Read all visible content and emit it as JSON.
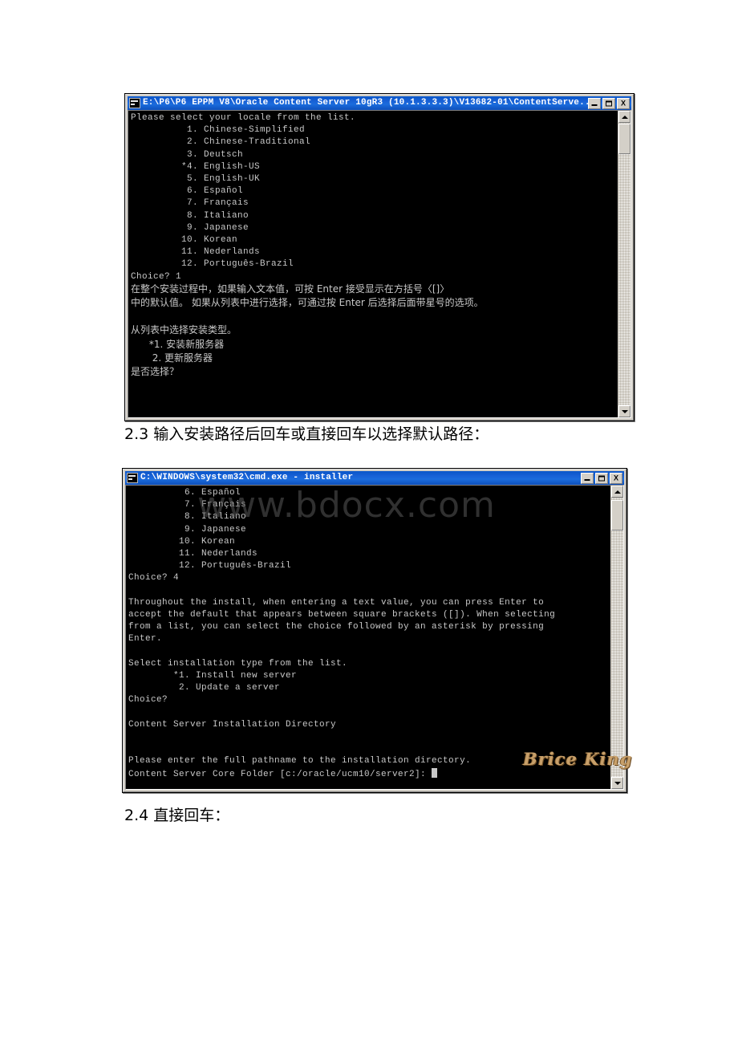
{
  "document": {
    "section_2_3": "2.3 输入安装路径后回车或直接回车以选择默认路径：",
    "section_2_4": "2.4 直接回车："
  },
  "watermarks": {
    "site": "www.bdocx.com",
    "author": "Brice King"
  },
  "window_locale": {
    "title": "E:\\P6\\P6 EPPM V8\\Oracle Content Server 10gR3  (10.1.3.3.3)\\V13682-01\\ContentServe...",
    "icon": "console-icon",
    "buttons": {
      "minimize": "minimize-button",
      "maximize": "maximize-button",
      "close_label": "X"
    },
    "console": "Please select your locale from the list.\n          1. Chinese-Simplified\n          2. Chinese-Traditional\n          3. Deutsch\n         *4. English-US\n          5. English-UK\n          6. Español\n          7. Français\n          8. Italiano\n          9. Japanese\n         10. Korean\n         11. Nederlands\n         12. Português-Brazil\nChoice? 1\n",
    "console_cn": "在整个安装过程中，如果输入文本值，可按 Enter 接受显示在方括号〈[]〉\n中的默认值。 如果从列表中进行选择，可通过按 Enter 后选择后面带星号的选项。\n\n从列表中选择安装类型。\n      *1. 安装新服务器\n       2. 更新服务器\n是否选择？",
    "scrollbar": {
      "up_arrow": "scroll-up-arrow",
      "down_arrow": "scroll-down-arrow",
      "thumb": "scroll-thumb"
    }
  },
  "window_installer": {
    "title": "C:\\WINDOWS\\system32\\cmd.exe - installer",
    "icon": "console-icon",
    "buttons": {
      "minimize": "minimize-button",
      "maximize": "maximize-button",
      "close_label": "X"
    },
    "console": "          6. Español\n          7. Français\n          8. Italiano\n          9. Japanese\n         10. Korean\n         11. Nederlands\n         12. Português-Brazil\nChoice? 4\n\nThroughout the install, when entering a text value, you can press Enter to\naccept the default that appears between square brackets ([]). When selecting\nfrom a list, you can select the choice followed by an asterisk by pressing\nEnter.\n\nSelect installation type from the list.\n        *1. Install new server\n         2. Update a server\nChoice?\n\nContent Server Installation Directory\n\n\nPlease enter the full pathname to the installation directory.\nContent Server Core Folder [c:/oracle/ucm10/server2]: ",
    "scrollbar": {
      "up_arrow": "scroll-up-arrow",
      "down_arrow": "scroll-down-arrow",
      "thumb": "scroll-thumb"
    }
  }
}
